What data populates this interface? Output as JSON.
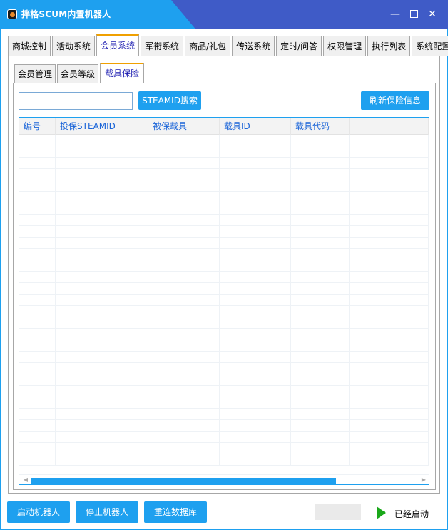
{
  "window": {
    "title": "拌格SCUM内置机器人",
    "minimize_glyph": "—",
    "close_glyph": "✕"
  },
  "top_tabs": [
    {
      "label": "商城控制",
      "active": false
    },
    {
      "label": "活动系统",
      "active": false
    },
    {
      "label": "会员系统",
      "active": true
    },
    {
      "label": "军衔系统",
      "active": false
    },
    {
      "label": "商品/礼包",
      "active": false
    },
    {
      "label": "传送系统",
      "active": false
    },
    {
      "label": "定时/问答",
      "active": false
    },
    {
      "label": "权限管理",
      "active": false
    },
    {
      "label": "执行列表",
      "active": false
    },
    {
      "label": "系统配置",
      "active": false
    }
  ],
  "sub_tabs": [
    {
      "label": "会员管理",
      "active": false
    },
    {
      "label": "会员等级",
      "active": false
    },
    {
      "label": "载具保险",
      "active": true
    }
  ],
  "search": {
    "value": "",
    "button_label": "STEAMID搜索"
  },
  "refresh_button_label": "刷新保险信息",
  "grid": {
    "columns": [
      "编号",
      "投保STEAMID",
      "被保载具",
      "载具ID",
      "载具代码",
      ""
    ],
    "empty_row_count": 29
  },
  "bottom": {
    "start_label": "启动机器人",
    "stop_label": "停止机器人",
    "reconnect_label": "重连数据库",
    "status_text": "已经启动"
  },
  "colors": {
    "accent": "#1ea0ef",
    "titlebar_dark": "#3f5bc7",
    "active_tab_border": "#f0a000",
    "running_indicator": "#1aa81a"
  }
}
